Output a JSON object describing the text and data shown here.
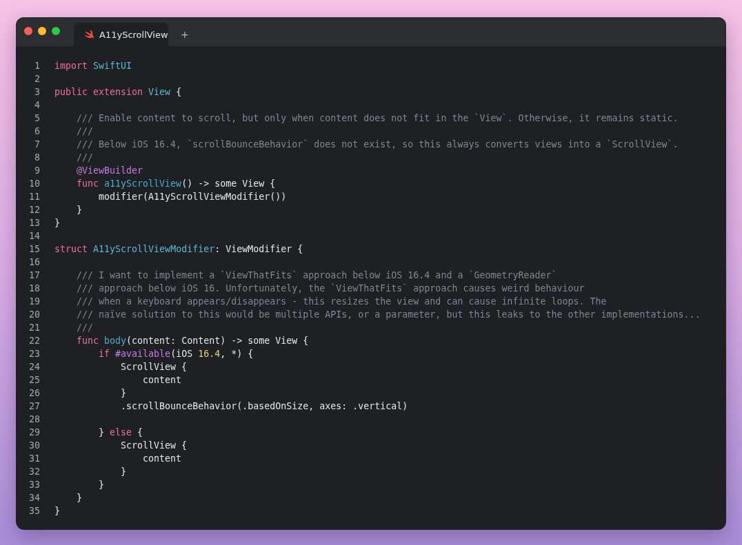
{
  "window": {
    "tab": {
      "title": "A11yScrollView",
      "selected": true
    },
    "new_tab": "+"
  },
  "code": {
    "lines": [
      {
        "number": "1",
        "tokens": [
          {
            "kind": "keyword",
            "text": "import"
          },
          {
            "kind": "type",
            "text": " SwiftUI"
          }
        ]
      },
      {
        "number": "2"
      },
      {
        "number": "3",
        "tokens": [
          {
            "kind": "keyword",
            "text": "public extension"
          },
          {
            "kind": "type",
            "text": " View"
          },
          {
            "kind": "plain",
            "text": " {"
          }
        ]
      },
      {
        "number": "4"
      },
      {
        "number": "5",
        "tokens": [
          {
            "kind": "comment",
            "text": "    /// Enable content to scroll, but only when content does not fit in the `View`. Otherwise, it remains static."
          }
        ]
      },
      {
        "number": "6",
        "tokens": [
          {
            "kind": "comment",
            "text": "    ///"
          }
        ]
      },
      {
        "number": "7",
        "tokens": [
          {
            "kind": "comment",
            "text": "    /// Below iOS 16.4, `scrollBounceBehavior` does not exist, so this always converts views into a `ScrollView`."
          }
        ]
      },
      {
        "number": "8",
        "tokens": [
          {
            "kind": "comment",
            "text": "    ///"
          }
        ]
      },
      {
        "number": "9",
        "tokens": [
          {
            "kind": "attribute",
            "text": "    @ViewBuilder"
          }
        ]
      },
      {
        "number": "10",
        "tokens": [
          {
            "kind": "keyword",
            "text": "    func"
          },
          {
            "kind": "declaration",
            "text": " a11yScrollView"
          },
          {
            "kind": "plain",
            "text": "() -> some View {"
          }
        ]
      },
      {
        "number": "11",
        "tokens": [
          {
            "kind": "plain",
            "text": "        modifier(A11yScrollViewModifier())"
          }
        ]
      },
      {
        "number": "12",
        "tokens": [
          {
            "kind": "plain",
            "text": "    }"
          }
        ]
      },
      {
        "number": "13",
        "tokens": [
          {
            "kind": "plain",
            "text": "}"
          }
        ]
      },
      {
        "number": "14"
      },
      {
        "number": "15",
        "tokens": [
          {
            "kind": "keyword",
            "text": "struct"
          },
          {
            "kind": "type",
            "text": " A11yScrollViewModifier"
          },
          {
            "kind": "plain",
            "text": ": ViewModifier {"
          }
        ]
      },
      {
        "number": "16"
      },
      {
        "number": "17",
        "tokens": [
          {
            "kind": "comment",
            "text": "    /// I want to implement a `ViewThatFits` approach below iOS 16.4 and a `GeometryReader`"
          }
        ]
      },
      {
        "number": "18",
        "tokens": [
          {
            "kind": "comment",
            "text": "    /// approach below iOS 16. Unfortunately, the `ViewThatFits` approach causes weird behaviour"
          }
        ]
      },
      {
        "number": "19",
        "tokens": [
          {
            "kind": "comment",
            "text": "    /// when a keyboard appears/disappears - this resizes the view and can cause infinite loops. The"
          }
        ]
      },
      {
        "number": "20",
        "tokens": [
          {
            "kind": "comment",
            "text": "    /// naïve solution to this would be multiple APIs, or a parameter, but this leaks to the other implementations..."
          }
        ]
      },
      {
        "number": "21",
        "tokens": [
          {
            "kind": "comment",
            "text": "    ///"
          }
        ]
      },
      {
        "number": "22",
        "tokens": [
          {
            "kind": "keyword",
            "text": "    func"
          },
          {
            "kind": "declaration",
            "text": " body"
          },
          {
            "kind": "plain",
            "text": "(content: Content) -> some View {"
          }
        ]
      },
      {
        "number": "23",
        "tokens": [
          {
            "kind": "keyword",
            "text": "        if"
          },
          {
            "kind": "attribute",
            "text": " #available"
          },
          {
            "kind": "plain",
            "text": "(iOS "
          },
          {
            "kind": "number",
            "text": "16.4"
          },
          {
            "kind": "plain",
            "text": ", *) {"
          }
        ]
      },
      {
        "number": "24",
        "tokens": [
          {
            "kind": "plain",
            "text": "            ScrollView {"
          }
        ]
      },
      {
        "number": "25",
        "tokens": [
          {
            "kind": "plain",
            "text": "                content"
          }
        ]
      },
      {
        "number": "26",
        "tokens": [
          {
            "kind": "plain",
            "text": "            }"
          }
        ]
      },
      {
        "number": "27",
        "tokens": [
          {
            "kind": "plain",
            "text": "            .scrollBounceBehavior(.basedOnSize, axes: .vertical)"
          }
        ]
      },
      {
        "number": "28"
      },
      {
        "number": "29",
        "tokens": [
          {
            "kind": "plain",
            "text": "        }"
          },
          {
            "kind": "keyword",
            "text": " else"
          },
          {
            "kind": "plain",
            "text": " {"
          }
        ]
      },
      {
        "number": "30",
        "tokens": [
          {
            "kind": "plain",
            "text": "            ScrollView {"
          }
        ]
      },
      {
        "number": "31",
        "tokens": [
          {
            "kind": "plain",
            "text": "                content"
          }
        ]
      },
      {
        "number": "32",
        "tokens": [
          {
            "kind": "plain",
            "text": "            }"
          }
        ]
      },
      {
        "number": "33",
        "tokens": [
          {
            "kind": "plain",
            "text": "        }"
          }
        ]
      },
      {
        "number": "34",
        "tokens": [
          {
            "kind": "plain",
            "text": "    }"
          }
        ]
      },
      {
        "number": "35",
        "tokens": [
          {
            "kind": "plain",
            "text": "}"
          }
        ]
      }
    ]
  }
}
